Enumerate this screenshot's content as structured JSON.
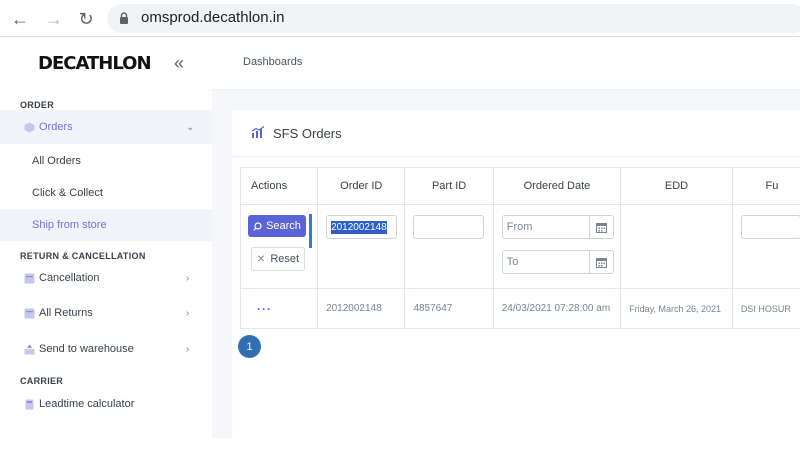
{
  "browser": {
    "url": "omsprod.decathlon.in"
  },
  "sidebar": {
    "logo": "DECATHLON",
    "collapse_icon": "double-chevron-left-icon",
    "sections": {
      "order": "ORDER",
      "returns": "RETURN & CANCELLATION",
      "carrier": "CARRIER"
    },
    "orders_label": "Orders",
    "sub_items": [
      "All Orders",
      "Click & Collect",
      "Ship from store"
    ],
    "cancellation": "Cancellation",
    "all_returns": "All Returns",
    "send_to_warehouse": "Send to warehouse",
    "leadtime": "Leadtime calculator"
  },
  "header": {
    "breadcrumb": "Dashboards"
  },
  "card": {
    "title": "SFS Orders"
  },
  "table": {
    "columns": [
      "Actions",
      "Order ID",
      "Part ID",
      "Ordered Date",
      "EDD",
      "Fu"
    ],
    "filters": {
      "search_label": "Search",
      "reset_label": "Reset",
      "order_id_value": "2012002148",
      "from_placeholder": "From",
      "to_placeholder": "To"
    },
    "row": {
      "actions": "···",
      "order_id": "2012002148",
      "part_id": "4857647",
      "ordered_date": "24/03/2021 07:28:00 am",
      "edd": "Friday, March 26, 2021",
      "fulfillment": "DSI HOSUR"
    }
  },
  "pagination": {
    "current_page": "1"
  },
  "colors": {
    "accent": "#5b63d6",
    "page_badge": "#2f6fb2",
    "active_bg": "#f3f4fb"
  }
}
